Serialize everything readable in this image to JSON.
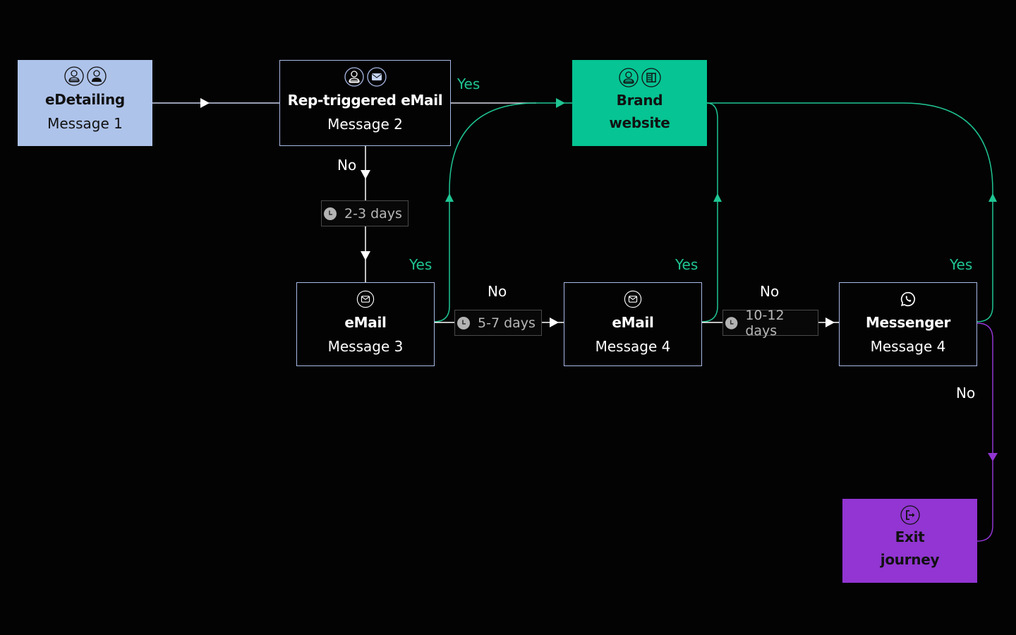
{
  "colors": {
    "background": "#030303",
    "neutral_border": "#a8b9e6",
    "edetailing_fill": "#aec3ea",
    "brand_fill": "#06c493",
    "exit_fill": "#9235d2",
    "yes_path": "#1fc593",
    "no_path": "#ffffff",
    "exit_path": "#9235d2",
    "delay_text": "#b7b7b7"
  },
  "nodes": {
    "edetailing": {
      "title": "eDetailing",
      "subtitle": "Message 1",
      "icons": [
        "rep-avatar-icon",
        "hcp-avatar-icon"
      ]
    },
    "rep_email": {
      "title": "Rep-triggered eMail",
      "subtitle": "Message 2",
      "icons": [
        "rep-avatar-icon",
        "envelope-icon"
      ]
    },
    "brand_website": {
      "title_line1": "Brand",
      "title_line2": "website",
      "icons": [
        "rep-avatar-icon",
        "webpage-icon"
      ]
    },
    "email3": {
      "title": "eMail",
      "subtitle": "Message 3",
      "icons": [
        "envelope-icon"
      ]
    },
    "email4": {
      "title": "eMail",
      "subtitle": "Message 4",
      "icons": [
        "envelope-icon"
      ]
    },
    "messenger": {
      "title": "Messenger",
      "subtitle": "Message 4",
      "icons": [
        "whatsapp-icon"
      ]
    },
    "exit": {
      "title_line1": "Exit",
      "title_line2": "journey",
      "icons": [
        "exit-icon"
      ]
    }
  },
  "delays": {
    "d1": "2-3 days",
    "d2": "5-7 days",
    "d3": "10-12 days"
  },
  "labels": {
    "yes_rep": "Yes",
    "no_rep": "No",
    "yes_email3": "Yes",
    "no_email3": "No",
    "yes_email4": "Yes",
    "no_email4": "No",
    "yes_messenger": "Yes",
    "no_messenger": "No"
  }
}
